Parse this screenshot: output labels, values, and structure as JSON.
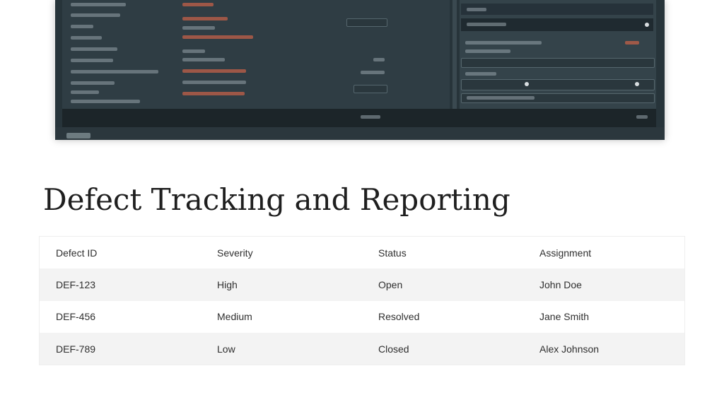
{
  "title": "Defect Tracking and Reporting",
  "table": {
    "headers": [
      "Defect ID",
      "Severity",
      "Status",
      "Assignment"
    ],
    "rows": [
      [
        "DEF-123",
        "High",
        "Open",
        "John Doe"
      ],
      [
        "DEF-456",
        "Medium",
        "Resolved",
        "Jane Smith"
      ],
      [
        "DEF-789",
        "Low",
        "Closed",
        "Alex Johnson"
      ]
    ]
  },
  "colors": {
    "screenshot_bg": "#27343a",
    "accent_red": "#c36048",
    "row_alt": "#f3f3f3"
  }
}
